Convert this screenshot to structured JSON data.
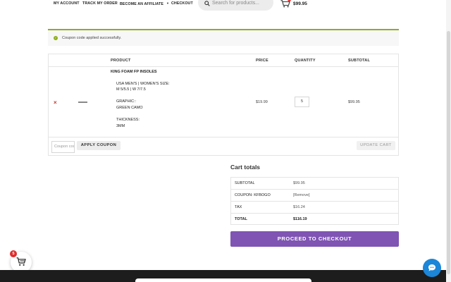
{
  "nav": {
    "my_account": "MY ACCOUNT",
    "track_order": "TRACK MY ORDER",
    "affiliate": "BECOME AN AFFILIATE",
    "checkout": "CHECKOUT",
    "search_placeholder": "Search for products...",
    "cart_total": "$99.95",
    "icons": [
      "search-icon",
      "cart-icon",
      "chevron-down-icon"
    ]
  },
  "notice": {
    "message": "Coupon code applied successfully."
  },
  "cart": {
    "headers": {
      "product": "PRODUCT",
      "price": "PRICE",
      "quantity": "QUANTITY",
      "subtotal": "SUBTOTAL"
    },
    "item": {
      "remove": "×",
      "name": "KING FOAM FP INSOLES",
      "size_label": "USA MEN'S | WOMEN'S SIZE:",
      "size_value": "M 5/5.5 | W 7/7.5",
      "graphic_label": "GRAPHIC::",
      "graphic_value": "GREEN CAMO",
      "thickness_label": "THICKNESS:",
      "thickness_value": "3MM",
      "price": "$19.99",
      "quantity": "5",
      "subtotal": "$99.95"
    },
    "coupon_placeholder": "Coupon code",
    "apply_label": "APPLY COUPON",
    "update_label": "UPDATE CART"
  },
  "totals": {
    "title": "Cart totals",
    "rows": [
      {
        "label": "SUBTOTAL",
        "value": "$99.95"
      },
      {
        "label": "COUPON: KFBOGO",
        "value": "[Remove]"
      },
      {
        "label": "TAX",
        "value": "$16.24"
      },
      {
        "label": "TOTAL",
        "value": "$116.19"
      }
    ],
    "checkout_label": "PROCEED TO CHECKOUT"
  },
  "floating": {
    "cart_count": "5"
  },
  "colors": {
    "accent": "#7f54b3",
    "success": "#8fae1b",
    "remove": "#c0392b",
    "chat": "#1c86d8",
    "badge": "#e02c2c"
  }
}
